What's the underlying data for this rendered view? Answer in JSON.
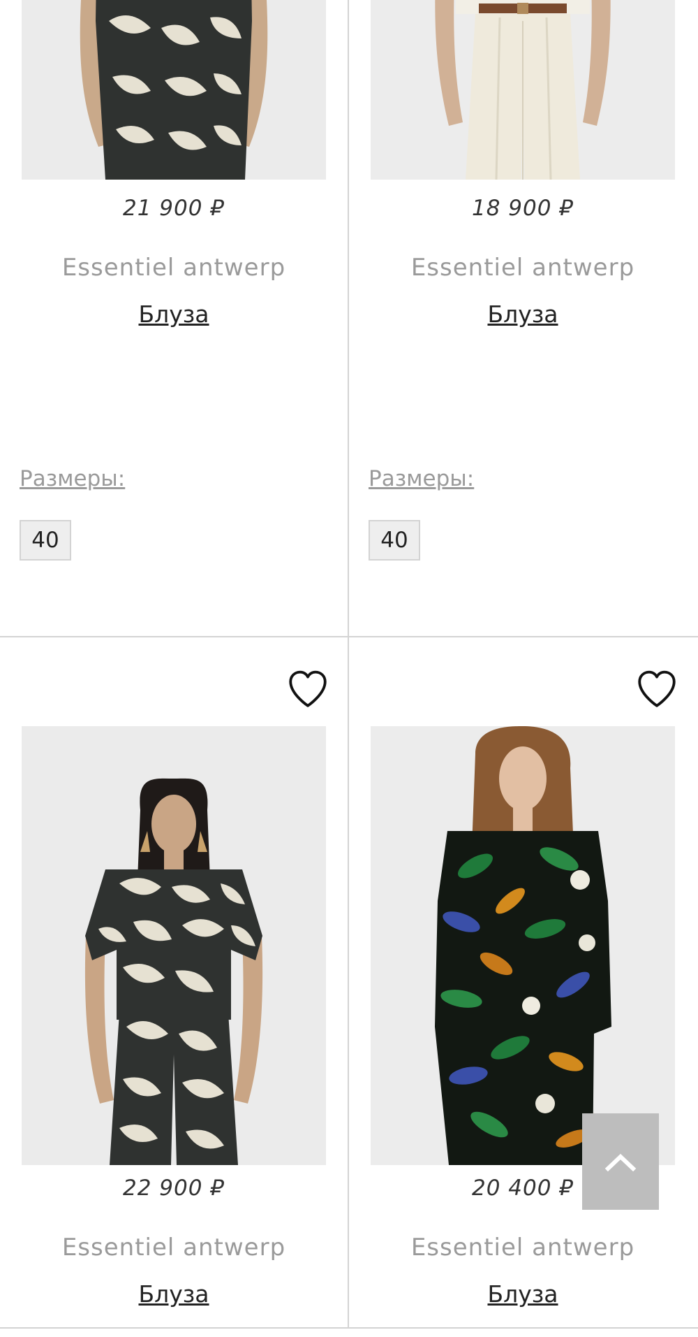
{
  "products": [
    {
      "price": "21 900 ₽",
      "brand": "Essentiel antwerp",
      "name": "Блуза",
      "sizes_label": "Размеры:",
      "sizes": [
        "40"
      ],
      "favorite_icon": "heart-outline-icon"
    },
    {
      "price": "18 900 ₽",
      "brand": "Essentiel antwerp",
      "name": "Блуза",
      "sizes_label": "Размеры:",
      "sizes": [
        "40"
      ],
      "favorite_icon": "heart-outline-icon"
    },
    {
      "price": "22 900 ₽",
      "brand": "Essentiel antwerp",
      "name": "Блуза",
      "favorite_icon": "heart-outline-icon"
    },
    {
      "price": "20 400 ₽",
      "brand": "Essentiel antwerp",
      "name": "Блуза",
      "favorite_icon": "heart-outline-icon"
    }
  ],
  "scroll_top_button": {
    "icon": "chevron-up-icon",
    "color": "#bdbdbd"
  },
  "colors": {
    "divider": "#d3d3d3",
    "brand_text": "#9a9a9a",
    "name_text": "#222222",
    "photo_bg": "#eeeeee"
  }
}
